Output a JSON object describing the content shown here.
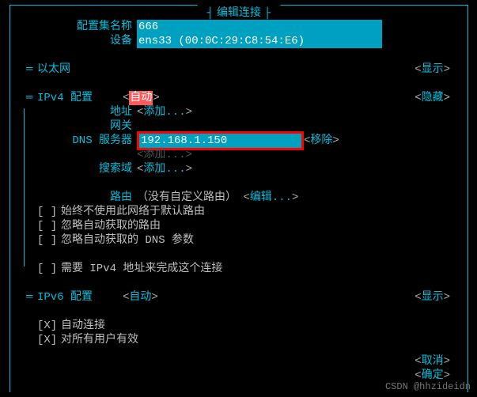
{
  "title": "编辑连接",
  "top": {
    "profile_label": "配置集名称",
    "profile_value": "666",
    "device_label": "设备",
    "device_value": "ens33 (00:0C:29:C8:54:E6)"
  },
  "sections": {
    "ethernet": {
      "label": "以太网",
      "action": "显示"
    },
    "ipv4": {
      "label": "IPv4 配置",
      "mode": "自动",
      "hide": "隐藏",
      "addr_label": "地址",
      "addr_add": "添加...",
      "gw_label": "网关",
      "dns_label": "DNS 服务器",
      "dns_value": "192.168.1.150",
      "dns_remove": "移除",
      "dns_add": "添加...",
      "search_label": "搜索域",
      "search_add": "添加...",
      "route_label": "路由",
      "route_text": "（没有自定义路由）",
      "route_edit": "编辑...",
      "cb1": "始终不使用此网络于默认路由",
      "cb2": "忽略自动获取的路由",
      "cb3": "忽略自动获取的 DNS 参数",
      "cb4": "需要 IPv4 地址来完成这个连接"
    },
    "ipv6": {
      "label": "IPv6 配置",
      "mode": "自动",
      "action": "显示"
    },
    "general": {
      "auto": "自动连接",
      "allusers": "对所有用户有效"
    }
  },
  "footer": {
    "cancel": "取消",
    "ok": "确定"
  },
  "watermark": "CSDN @hhzideidn"
}
